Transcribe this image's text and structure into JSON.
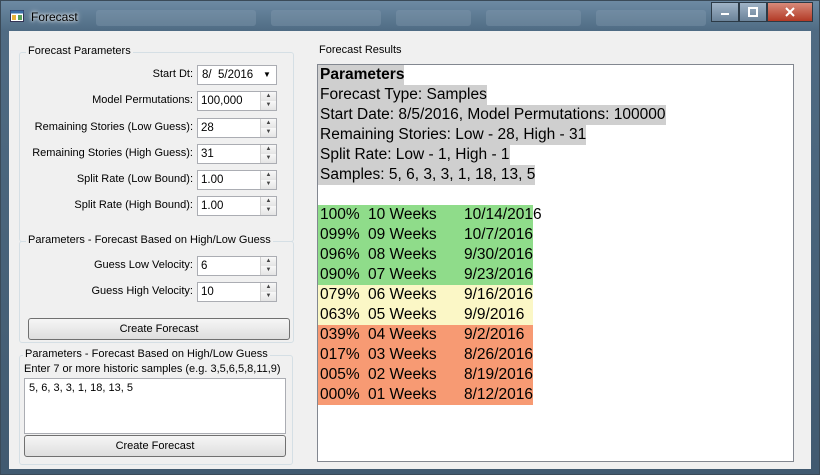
{
  "window": {
    "title": "Forecast"
  },
  "params": {
    "group_title": "Forecast Parameters",
    "fields": [
      {
        "label": "Start Dt:",
        "value": "8/  5/2016"
      },
      {
        "label": "Model Permutations:",
        "value": "100,000"
      },
      {
        "label": "Remaining Stories (Low Guess):",
        "value": "28"
      },
      {
        "label": "Remaining Stories (High Guess):",
        "value": "31"
      },
      {
        "label": "Split Rate (Low Bound):",
        "value": "1.00"
      },
      {
        "label": "Split Rate (High Bound):",
        "value": "1.00"
      }
    ]
  },
  "guess_group": {
    "title": "Parameters - Forecast Based on High/Low Guess",
    "fields": [
      {
        "label": "Guess Low Velocity:",
        "value": "6"
      },
      {
        "label": "Guess High Velocity:",
        "value": "10"
      }
    ],
    "button": "Create Forecast"
  },
  "samples_group": {
    "title": "Parameters - Forecast Based on High/Low Guess",
    "instruction": "Enter 7 or more historic samples (e.g. 3,5,6,5,8,11,9)",
    "value": "5, 6, 3, 3, 1, 18, 13, 5",
    "button": "Create Forecast"
  },
  "results": {
    "group_title": "Forecast Results",
    "header": "Parameters",
    "lines": [
      "Forecast Type: Samples",
      "Start Date: 8/5/2016, Model Permutations: 100000",
      "Remaining Stories: Low - 28, High - 31",
      "Split Rate: Low - 1, High - 1",
      "Samples: 5, 6, 3, 3, 1, 18, 13, 5"
    ],
    "rows": [
      {
        "pct": "100%",
        "weeks": "10 Weeks",
        "date": "10/14/2016",
        "band": "green"
      },
      {
        "pct": "099%",
        "weeks": "09 Weeks",
        "date": "10/7/2016",
        "band": "green"
      },
      {
        "pct": "096%",
        "weeks": "08 Weeks",
        "date": "9/30/2016",
        "band": "green"
      },
      {
        "pct": "090%",
        "weeks": "07 Weeks",
        "date": "9/23/2016",
        "band": "green"
      },
      {
        "pct": "079%",
        "weeks": "06 Weeks",
        "date": "9/16/2016",
        "band": "yellow"
      },
      {
        "pct": "063%",
        "weeks": "05 Weeks",
        "date": "9/9/2016",
        "band": "yellow"
      },
      {
        "pct": "039%",
        "weeks": "04 Weeks",
        "date": "9/2/2016",
        "band": "salmon"
      },
      {
        "pct": "017%",
        "weeks": "03 Weeks",
        "date": "8/26/2016",
        "band": "salmon"
      },
      {
        "pct": "005%",
        "weeks": "02 Weeks",
        "date": "8/19/2016",
        "band": "salmon"
      },
      {
        "pct": "000%",
        "weeks": "01 Weeks",
        "date": "8/12/2016",
        "band": "salmon"
      }
    ]
  },
  "colors": {
    "green": "#8fdc8a",
    "yellow": "#fbf7c6",
    "salmon": "#f79a73",
    "gray": "#cfcfcf"
  },
  "icons": {
    "app": "app-window-icon",
    "minimize": "minimize-icon",
    "maximize": "maximize-icon",
    "close": "close-icon"
  }
}
